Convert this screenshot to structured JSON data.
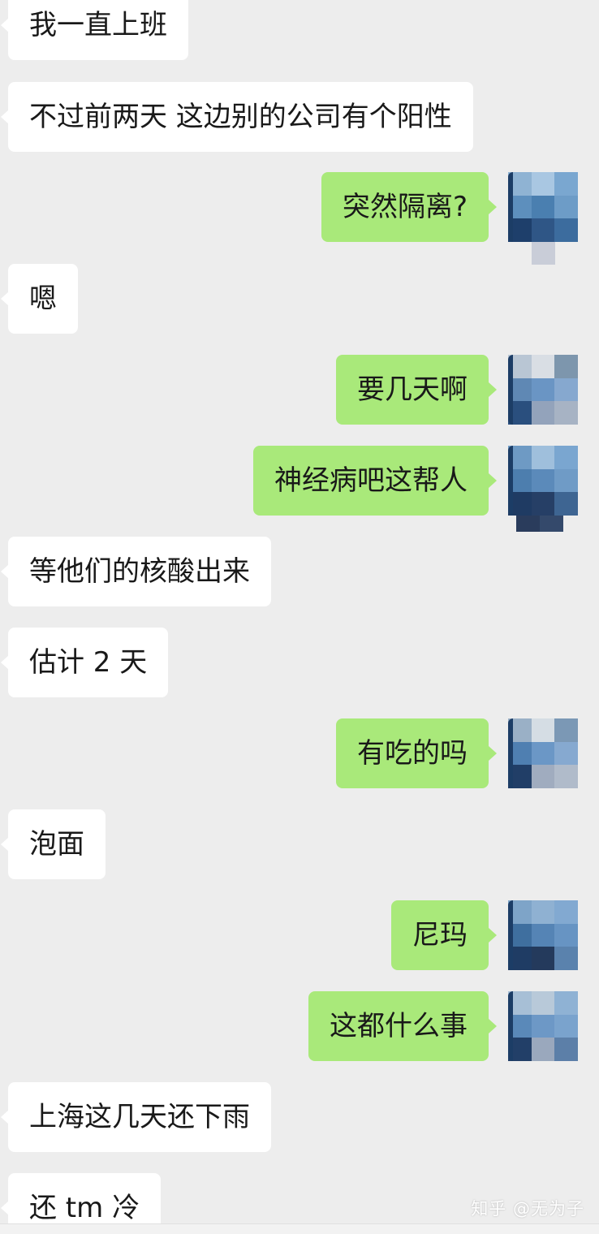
{
  "messages": [
    {
      "side": "left",
      "text": "我一直上班"
    },
    {
      "side": "left",
      "text": "不过前两天 这边别的公司有个阳性"
    },
    {
      "side": "right",
      "text": "突然隔离?"
    },
    {
      "side": "left",
      "text": "嗯"
    },
    {
      "side": "right",
      "text": "要几天啊"
    },
    {
      "side": "right",
      "text": "神经病吧这帮人"
    },
    {
      "side": "left",
      "text": "等他们的核酸出来"
    },
    {
      "side": "left",
      "text": "估计 2 天"
    },
    {
      "side": "right",
      "text": "有吃的吗"
    },
    {
      "side": "left",
      "text": "泡面"
    },
    {
      "side": "right",
      "text": "尼玛"
    },
    {
      "side": "right",
      "text": "这都什么事"
    },
    {
      "side": "left",
      "text": "上海这几天还下雨"
    },
    {
      "side": "left",
      "text": "还 tm 冷"
    }
  ],
  "watermark": "知乎 @无为子",
  "avatar_icon": "pixelated-avatar-icon",
  "colors": {
    "background": "#ededed",
    "incoming_bubble": "#ffffff",
    "outgoing_bubble": "#a9e97a",
    "text": "#191919"
  }
}
